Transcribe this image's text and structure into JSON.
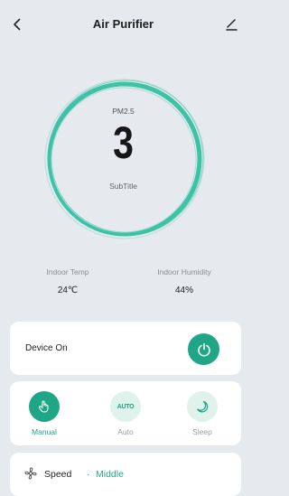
{
  "header": {
    "title": "Air Purifier",
    "back_icon": "chevron-left-icon",
    "edit_icon": "pencil-icon"
  },
  "gauge": {
    "metric_label": "PM2.5",
    "value": "3",
    "subtitle": "SubTitle",
    "ring_color": "#3cc3a6"
  },
  "stats": [
    {
      "label": "Indoor Temp",
      "value": "24℃"
    },
    {
      "label": "Indoor Humidity",
      "value": "44%"
    }
  ],
  "power": {
    "label": "Device On",
    "icon": "power-icon",
    "on": true
  },
  "modes": [
    {
      "label": "Manual",
      "icon": "hand-pointer-icon",
      "active": true
    },
    {
      "label": "Auto",
      "icon": "auto-icon",
      "icon_text": "AUTO",
      "active": false
    },
    {
      "label": "Sleep",
      "icon": "moon-icon",
      "active": false
    }
  ],
  "speed": {
    "icon": "fan-icon",
    "label": "Speed",
    "separator": "·",
    "value": "Middle"
  },
  "colors": {
    "accent": "#1fa686",
    "accent_light": "#dff2ec",
    "background": "#e6e9ed",
    "card": "#ffffff"
  }
}
